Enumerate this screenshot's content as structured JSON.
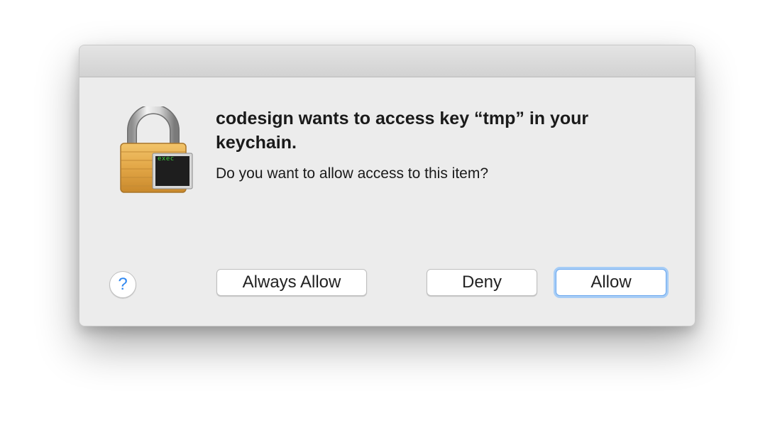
{
  "dialog": {
    "heading": "codesign wants to access key “tmp” in your keychain.",
    "message": "Do you want to allow access to this item?",
    "icon": {
      "name": "keychain-lock-icon",
      "badge_text": "exec"
    },
    "buttons": {
      "help_label": "?",
      "always_allow_label": "Always Allow",
      "deny_label": "Deny",
      "allow_label": "Allow"
    },
    "colors": {
      "default_button_focus": "#a7cdf6",
      "help_glyph": "#2f87f0",
      "badge_text": "#3fd33f"
    }
  }
}
